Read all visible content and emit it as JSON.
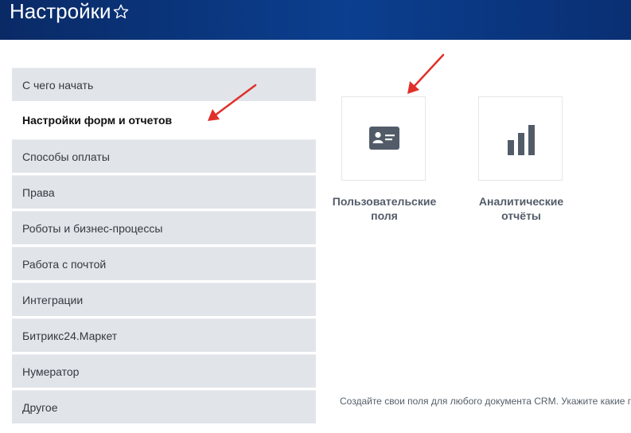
{
  "header": {
    "title": "Настройки"
  },
  "menu": {
    "items": [
      {
        "label": "С чего начать"
      },
      {
        "label": "Настройки форм и отчетов"
      },
      {
        "label": "Способы оплаты"
      },
      {
        "label": "Права"
      },
      {
        "label": "Роботы и бизнес-процессы"
      },
      {
        "label": "Работа с почтой"
      },
      {
        "label": "Интеграции"
      },
      {
        "label": "Битрикс24.Маркет"
      },
      {
        "label": "Нумератор"
      },
      {
        "label": "Другое"
      }
    ]
  },
  "tiles": [
    {
      "label": "Пользовательские поля",
      "icon": "id-card-icon"
    },
    {
      "label": "Аналитические отчёты",
      "icon": "bar-chart-icon"
    }
  ],
  "description": "Создайте свои поля для любого документа CRM. Укажите какие г",
  "colors": {
    "header": "#0b3f8f",
    "menu_item_bg": "#e1e4e9",
    "icon": "#525c69",
    "arrow": "#e0302a"
  }
}
